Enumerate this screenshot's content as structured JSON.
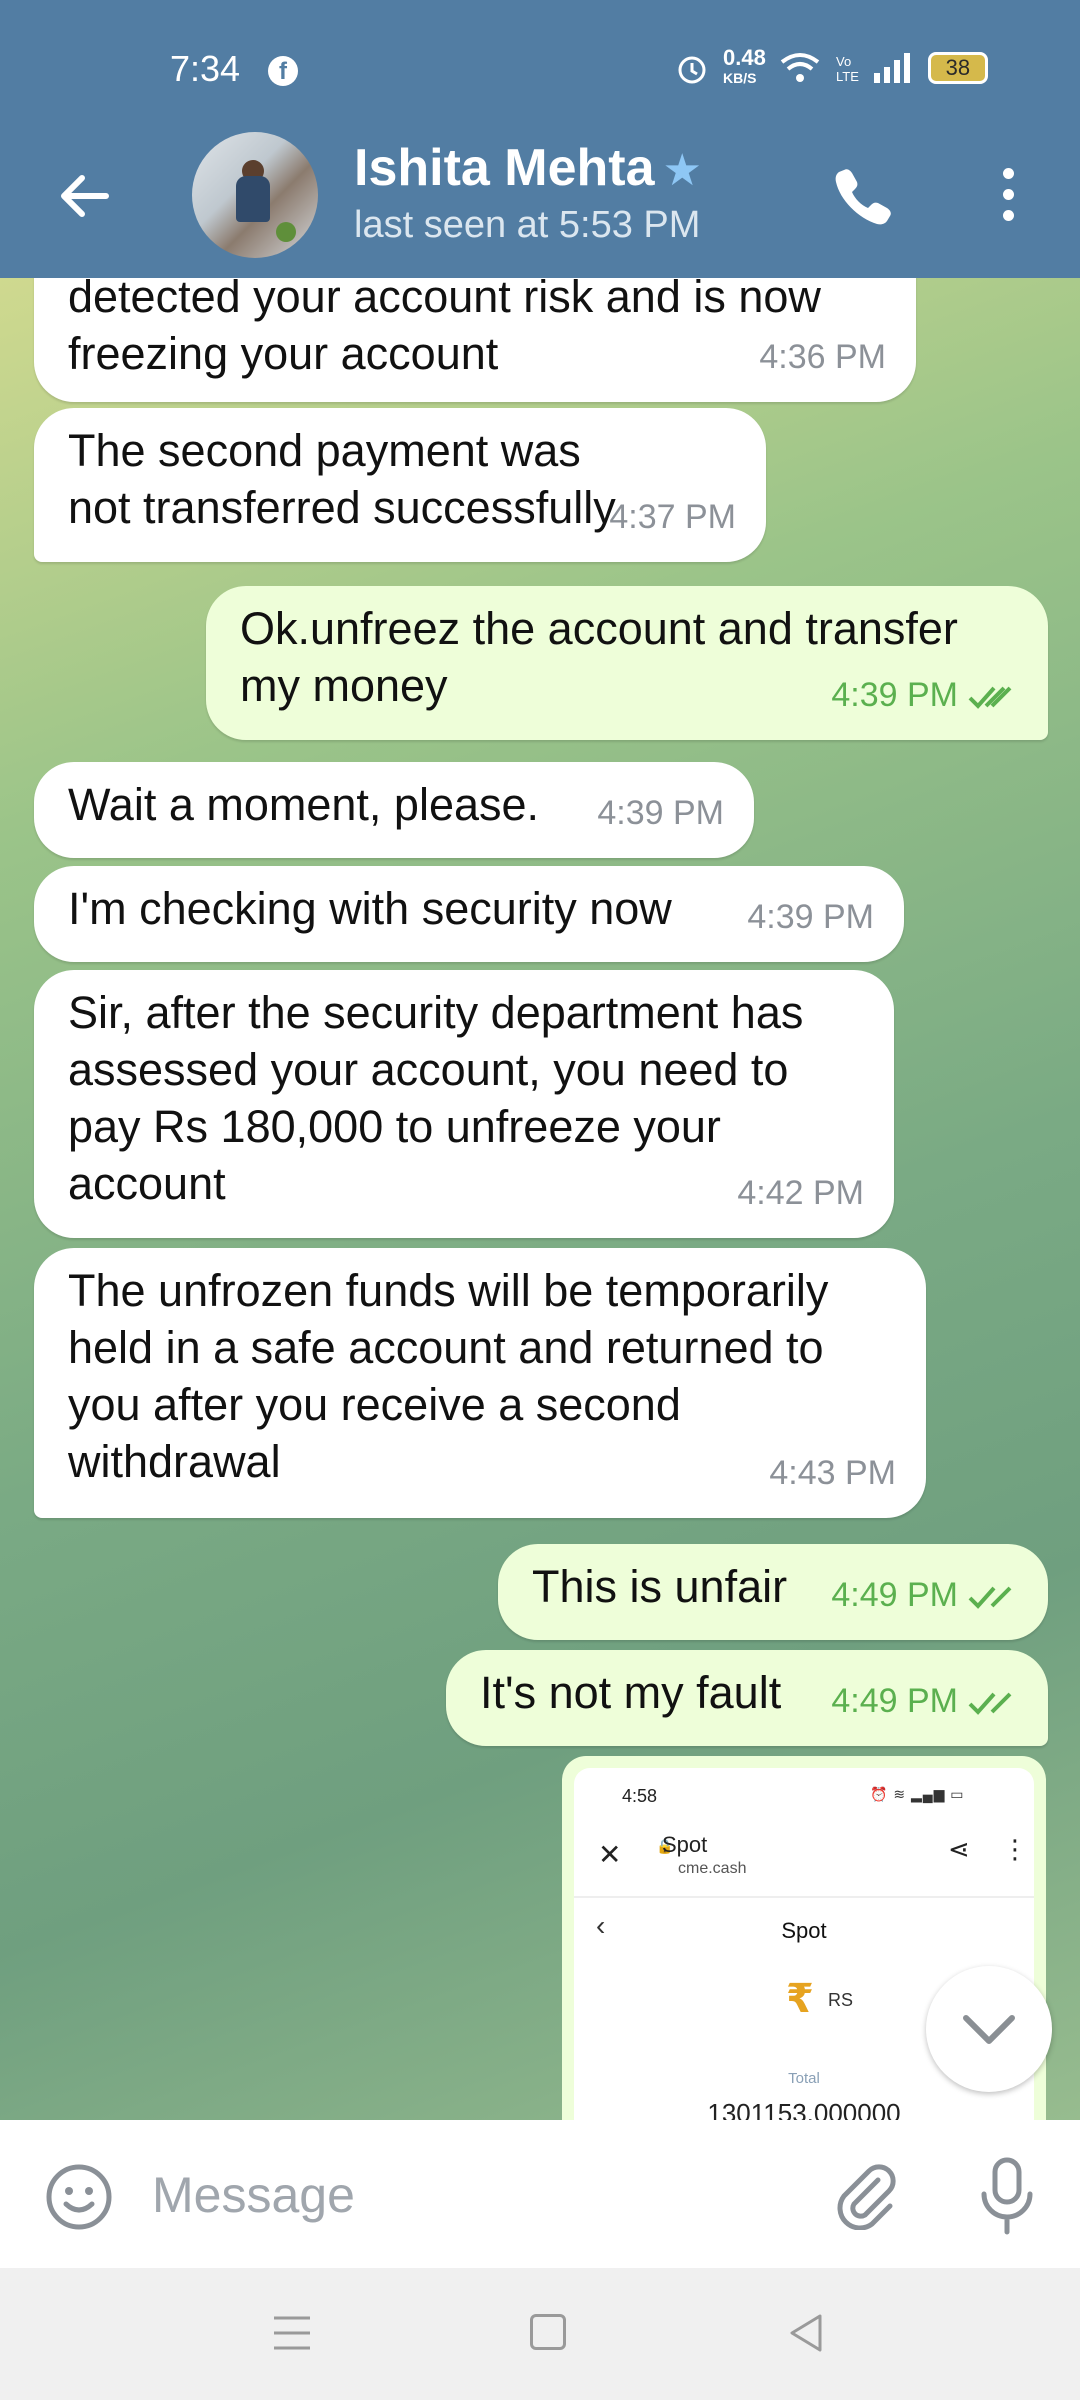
{
  "status_bar": {
    "time": "7:34",
    "network_speed": "0.48",
    "network_unit": "KB/S",
    "battery": "38"
  },
  "header": {
    "contact_name": "Ishita Mehta",
    "last_seen": "last seen at 5:53 PM"
  },
  "messages": [
    {
      "side": "in",
      "text": "detected your account risk and is now freezing your account",
      "time": "4:36 PM"
    },
    {
      "side": "in",
      "text": "The second payment was not transferred successfully",
      "time": "4:37 PM"
    },
    {
      "side": "out",
      "text": "Ok.unfreez the account and transfer my money",
      "time": "4:39 PM"
    },
    {
      "side": "in",
      "text": "Wait a moment, please.",
      "time": "4:39 PM"
    },
    {
      "side": "in",
      "text": "I'm checking with security now",
      "time": "4:39 PM"
    },
    {
      "side": "in",
      "text": "Sir, after the security department has assessed your account, you need to pay Rs 180,000 to unfreeze your account",
      "time": "4:42 PM"
    },
    {
      "side": "in",
      "text": "The unfrozen funds will be temporarily held in a safe account and returned to you after you receive a second withdrawal",
      "time": "4:43 PM"
    },
    {
      "side": "out",
      "text": "This is unfair",
      "time": "4:49 PM"
    },
    {
      "side": "out",
      "text": "It's not my fault",
      "time": "4:49 PM"
    }
  ],
  "screenshot_message": {
    "time": "4:58",
    "page_title": "Spot",
    "url": "cme.cash",
    "heading": "Spot",
    "currency": "RS",
    "total_label": "Total",
    "total_value": "1301153.000000"
  },
  "composer": {
    "placeholder": "Message"
  },
  "icons": {
    "back": "back-arrow-icon",
    "call": "phone-icon",
    "more": "more-vert-icon",
    "emoji": "emoji-icon",
    "attach": "paperclip-icon",
    "mic": "microphone-icon",
    "scroll": "chevron-down-icon",
    "star": "star-icon"
  },
  "colors": {
    "header": "#527da3",
    "incoming_bubble": "#ffffff",
    "outgoing_bubble": "#eefed9",
    "outgoing_time": "#5bb04f"
  }
}
